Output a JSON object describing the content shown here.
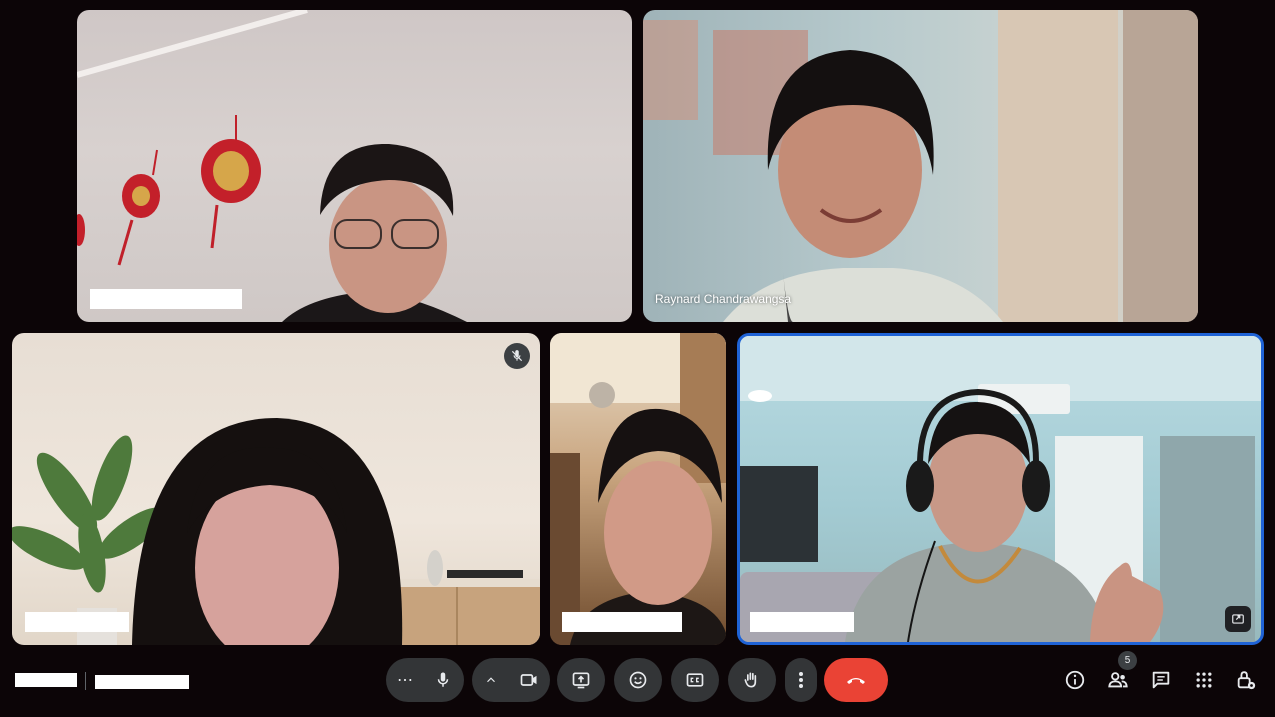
{
  "participants": [
    {
      "id": "tile-1",
      "name": ""
    },
    {
      "id": "tile-2",
      "name": "Raynard Chandrawangsa"
    },
    {
      "id": "tile-3",
      "name": "",
      "muted": true
    },
    {
      "id": "tile-4",
      "name": ""
    },
    {
      "id": "tile-5",
      "name": "",
      "active_speaker": true
    }
  ],
  "meeting": {
    "time": "",
    "code": ""
  },
  "controls": {
    "more_options_label": "⋯",
    "people_count": "5"
  },
  "colors": {
    "background": "#0c0507",
    "control_bg": "#333537",
    "end_call": "#ea4335",
    "active_speaker_border": "#1f63d6"
  },
  "icons": {
    "mic": "microphone-icon",
    "camera": "videocam-icon",
    "present": "present-screen-icon",
    "reactions": "emoji-icon",
    "captions": "closed-captions-icon",
    "raise_hand": "raise-hand-icon",
    "more": "more-vert-icon",
    "end": "call-end-icon",
    "info": "info-icon",
    "people": "people-icon",
    "chat": "chat-icon",
    "activities": "apps-grid-icon",
    "host_controls": "lock-settings-icon"
  }
}
